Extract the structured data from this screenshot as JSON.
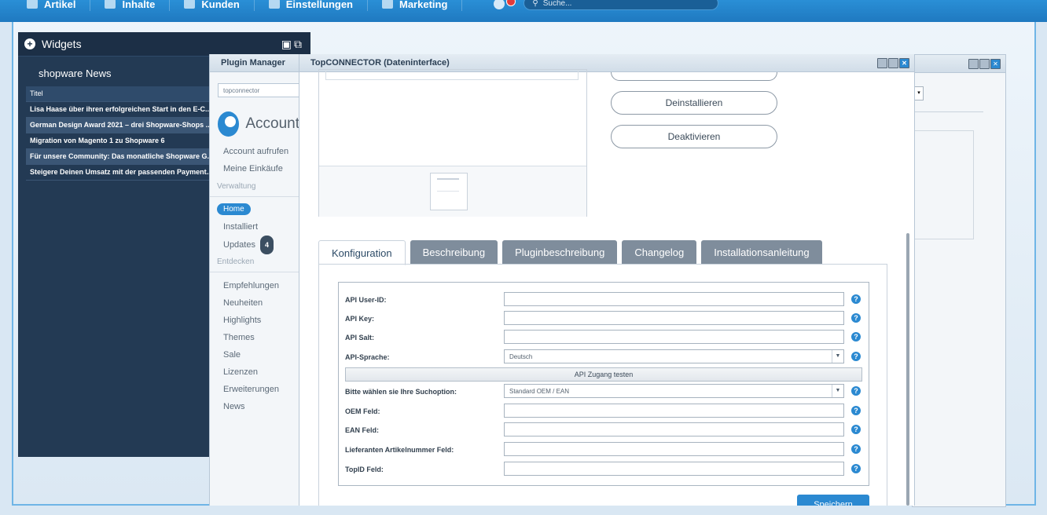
{
  "nav": {
    "items": [
      {
        "label": "Artikel",
        "icon": "box-icon"
      },
      {
        "label": "Inhalte",
        "icon": "document-icon"
      },
      {
        "label": "Kunden",
        "icon": "users-icon"
      },
      {
        "label": "Einstellungen",
        "icon": "gear-icon"
      },
      {
        "label": "Marketing",
        "icon": "marketing-icon"
      }
    ],
    "search_placeholder": "Suche..."
  },
  "widgets": {
    "title": "Widgets",
    "news_title": "shopware News",
    "table_header": "Titel",
    "news": [
      "Lisa Haase über ihren erfolgreichen Start in den E-C...",
      "German Design Award 2021 – drei Shopware-Shops ...",
      "Migration von Magento 1 zu Shopware 6",
      "Für unsere Community: Das monatliche Shopware G...",
      "Steigere Deinen Umsatz mit der passenden Payment..."
    ]
  },
  "plugin_manager": {
    "title": "Plugin Manager",
    "search_value": "topconnector",
    "account_name": "Account",
    "account_links": [
      "Account aufrufen",
      "Meine Einkäufe"
    ],
    "section_admin": "Verwaltung",
    "home": "Home",
    "installed": "Installiert",
    "updates": "Updates",
    "updates_count": "4",
    "section_discover": "Entdecken",
    "discover_links": [
      "Empfehlungen",
      "Neuheiten",
      "Highlights",
      "Themes",
      "Sale",
      "Lizenzen",
      "Erweiterungen",
      "News"
    ]
  },
  "topconnector": {
    "title": "TopCONNECTOR (Dateninterface)",
    "buttons": {
      "uninstall": "Deinstallieren",
      "deactivate": "Deaktivieren"
    },
    "tabs": [
      "Konfiguration",
      "Beschreibung",
      "Pluginbeschreibung",
      "Changelog",
      "Installationsanleitung"
    ],
    "form": {
      "api_user_id": "API User-ID:",
      "api_key": "API Key:",
      "api_salt": "API Salt:",
      "api_language": "API-Sprache:",
      "api_language_value": "Deutsch",
      "test_button": "API Zugang testen",
      "search_option": "Bitte wählen sie Ihre Suchoption:",
      "search_option_value": "Standard OEM / EAN",
      "oem_field": "OEM Feld:",
      "ean_field": "EAN Feld:",
      "supplier_field": "Lieferanten Artikelnummer Feld:",
      "topid_field": "TopID Feld:",
      "help": "?"
    },
    "save": "Speichern"
  }
}
